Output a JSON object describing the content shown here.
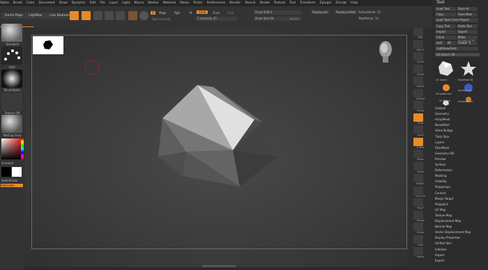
{
  "menu": [
    "Alpha",
    "Brush",
    "Color",
    "Document",
    "Draw",
    "Dynamic",
    "Edit",
    "File",
    "Layer",
    "Light",
    "Macro",
    "Marker",
    "Material",
    "Movie",
    "Picker",
    "Preferences",
    "Render",
    "Stencil",
    "Stroke",
    "Texture",
    "Tool",
    "Transform",
    "Zplugin",
    "Zscript",
    "Help"
  ],
  "tabs": {
    "home": "Home Page",
    "lightbox": "LightBox",
    "livebool": "Live Boolean"
  },
  "toolbar": {
    "edit": "Edit",
    "draw": "Draw",
    "move": "Move",
    "scale": "Scale",
    "rotate": "Rotate",
    "a": "A",
    "mrgb": "Mrgb",
    "rgb": "Rgb",
    "m": "M",
    "zadd": "Zadd",
    "zsub": "Zsub",
    "zcut": "Zcut",
    "rgb_intensity": "Rgb Intensity",
    "z_intensity": "Z Intensity 25",
    "focal_shift": "Focal Shift 0",
    "draw_size": "Draw Size 64",
    "dynamic": "Dynamic",
    "replay_last": "ReplayLast",
    "replay_last_rel": "ReplayLastRel",
    "active_points": "ActivePoints: 12",
    "total_points": "TotalPoints: 12"
  },
  "left": {
    "standard": "Standard",
    "dots": "Dots",
    "brushalpha": "BrushAlpha",
    "texture_off": "Texture Off",
    "matcap": "MatCap Gray",
    "gradient": "Gradient",
    "switchcolor": "SwitchColor",
    "alternate": "Alternate"
  },
  "shelf": [
    "BPR",
    "SPix 3",
    "Scroll",
    "Zoom",
    "Actual",
    "AAHalf",
    "Persp",
    "Floor",
    "Local",
    "Frame",
    "Move",
    "Scale",
    "Rotate",
    "Line Fill",
    "PolyF",
    "Transp",
    "Ghost",
    "Solo",
    "Xpose"
  ],
  "tray": {
    "title": "Tool",
    "buttons": [
      [
        "Load Tool",
        "Save As"
      ],
      [
        "Copy",
        "Save New"
      ],
      [
        "Load Tools From Project",
        ""
      ],
      [
        "Copy Tool",
        "Paste Tool"
      ],
      [
        "Import",
        "Export"
      ],
      [
        "Clone",
        "Make PolyMesh3D"
      ],
      [
        "GoZ",
        "All",
        "Visible",
        "R"
      ],
      [
        "Lightbox▸Tools",
        ""
      ]
    ],
    "count": "20 Select: 48",
    "thumbs": [
      "20 Select",
      "PolyMesh3D",
      "AlphaBrush",
      "SimpleBrush",
      "EraserBrush",
      "20 Select"
    ],
    "subs": [
      "Subtool",
      "Geometry",
      "ArrayMesh",
      "NanoMesh",
      "Slime Bridge",
      "Thick Skin",
      "Layers",
      "FiberMesh",
      "Geometry HD",
      "Preview",
      "Surface",
      "Deformation",
      "Masking",
      "Visibility",
      "Polygroups",
      "Contact",
      "Morph Target",
      "Polypaint",
      "UV Map",
      "Texture Map",
      "Displacement Map",
      "Normal Map",
      "Vector Displacement Map",
      "Display Properties",
      "Unified Skin",
      "Initialize",
      "Import",
      "Export"
    ]
  },
  "colors": {
    "accent": "#e88a2c",
    "panel": "#333333",
    "canvas": "#3a3a3a"
  }
}
